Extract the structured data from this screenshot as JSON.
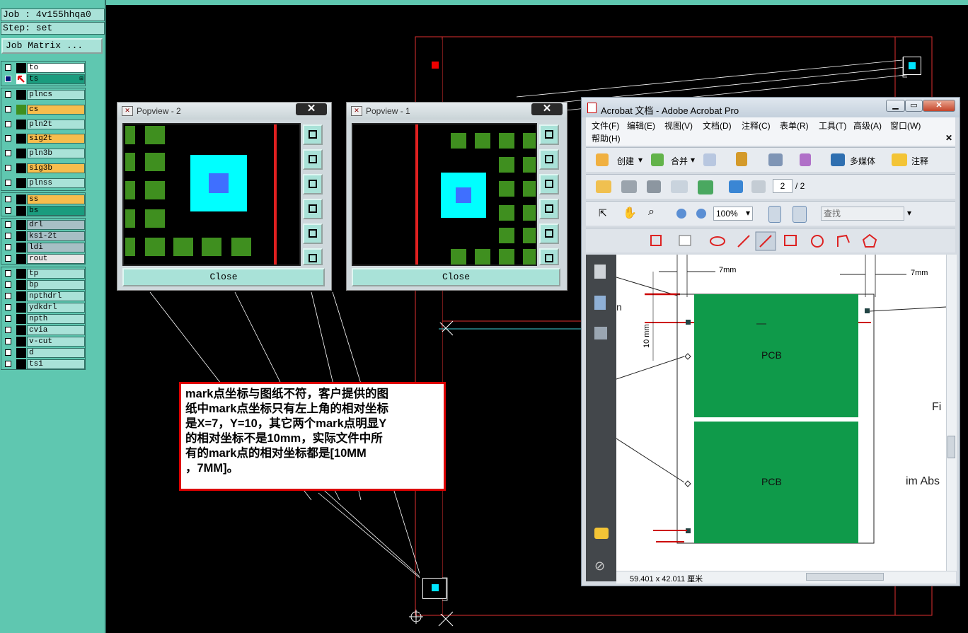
{
  "left_panel": {
    "job": "Job : 4v155hhqa0",
    "step": "Step: set",
    "matrix_button": "Job Matrix ...",
    "group1": [
      {
        "name": "to",
        "color": "#ffffff",
        "checked": false
      },
      {
        "name": "ts",
        "color": "#1a9c7e",
        "checked": true
      }
    ],
    "group2": [
      {
        "name": "plncs",
        "color": "#a9e2d8"
      },
      {
        "name": "cs",
        "color": "#f7bd4d"
      },
      {
        "name": "pln2t",
        "color": "#a9e2d8"
      },
      {
        "name": "sig2t",
        "color": "#f7bd4d"
      },
      {
        "name": "pln3b",
        "color": "#a9e2d8"
      },
      {
        "name": "sig3b",
        "color": "#f7bd4d"
      },
      {
        "name": "plnss",
        "color": "#a9e2d8"
      }
    ],
    "group3": [
      {
        "name": "ss",
        "color": "#f7bd4d"
      },
      {
        "name": "bs",
        "color": "#1a9c7e"
      }
    ],
    "group4": [
      {
        "name": "drl",
        "color": "#a7bfc5"
      },
      {
        "name": "ks1-2t",
        "color": "#a7bfc5"
      },
      {
        "name": "ldi",
        "color": "#a7bfc5"
      },
      {
        "name": "rout",
        "color": "#e6e6e6"
      }
    ],
    "group5": [
      {
        "name": "tp"
      },
      {
        "name": "bp"
      },
      {
        "name": "npthdrl"
      },
      {
        "name": "ydkdrl"
      },
      {
        "name": "npth"
      },
      {
        "name": "cvia"
      },
      {
        "name": "v-cut"
      },
      {
        "name": "d"
      },
      {
        "name": "ts1"
      }
    ]
  },
  "popview2": {
    "title": "Popview - 2",
    "close_x": "✕",
    "close_button": "Close"
  },
  "popview1": {
    "title": "Popview - 1",
    "close_x": "✕",
    "close_button": "Close"
  },
  "annotation": {
    "lines": [
      "mark点坐标与图纸不符，客户提供的图",
      "纸中mark点坐标只有左上角的相对坐标",
      "是X=7，Y=10，其它两个mark点明显Y",
      "的相对坐标不是10mm，实际文件中所",
      "有的mark点的相对坐标都是[10MM",
      "，7MM]。"
    ]
  },
  "acrobat": {
    "title": "Acrobat 文档 - Adobe Acrobat Pro",
    "menu": [
      "文件(F)",
      "编辑(E)",
      "视图(V)",
      "文档(D)",
      "注释(C)",
      "表单(R)",
      "工具(T)",
      "高级(A)",
      "窗口(W)",
      "帮助(H)"
    ],
    "toolbar1": {
      "create": "创建",
      "merge": "合并",
      "multimedia": "多媒体",
      "comment": "注释"
    },
    "page_current": "2",
    "page_total": "/ 2",
    "zoom": "100%",
    "search_placeholder": "查找",
    "doc": {
      "dim_top_left": "7mm",
      "dim_top_right": "7mm",
      "dim_left": "10 mm",
      "pcb_label_1": "PCB",
      "pcb_label_2": "PCB",
      "side_text_1": "Fi",
      "side_text_2": "im Abs",
      "side_text_left": "n"
    },
    "status_size": "59.401 x 42.011 厘米"
  }
}
